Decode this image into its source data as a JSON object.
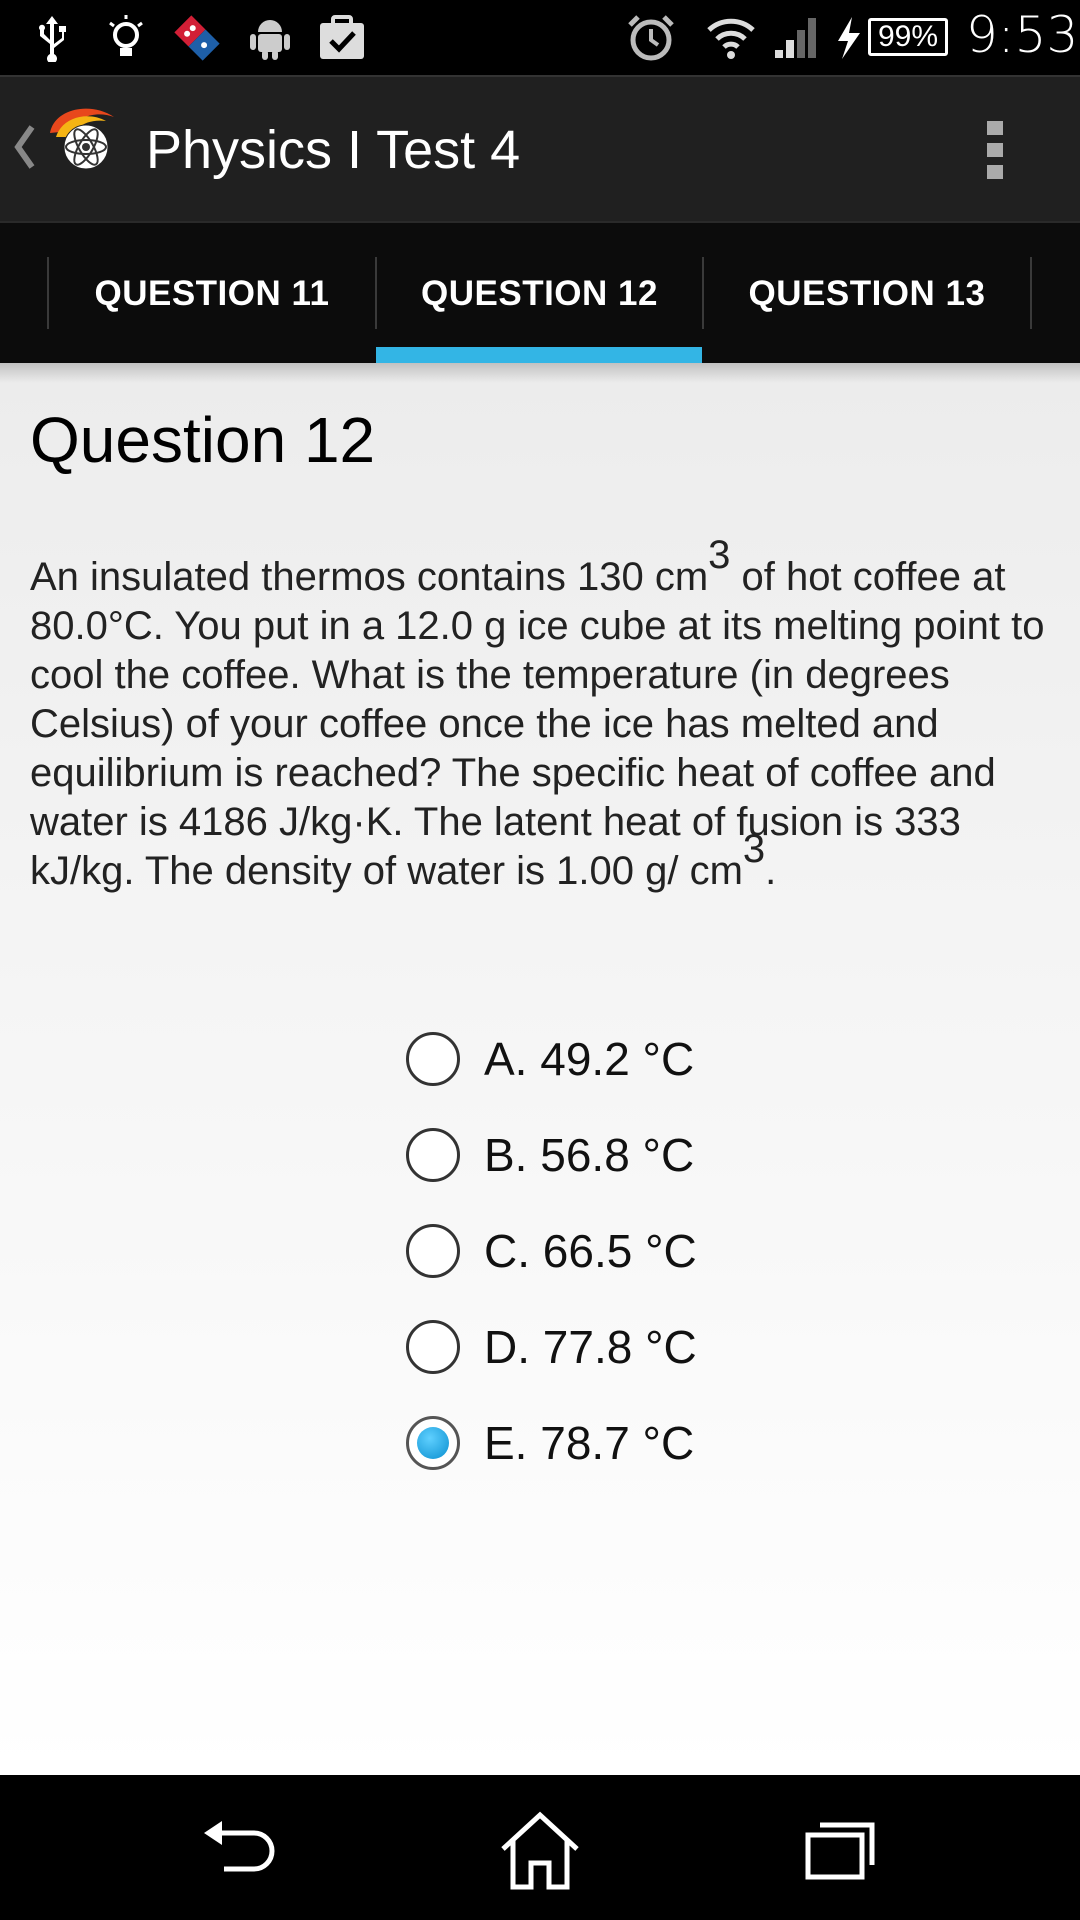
{
  "status_bar": {
    "icons": [
      "usb-icon",
      "lightbulb-icon",
      "dominos-icon",
      "android-icon",
      "clipboard-check-icon",
      "alarm-icon",
      "wifi-icon",
      "signal-icon",
      "charging-icon"
    ],
    "battery": "99%",
    "time": "9:53"
  },
  "action_bar": {
    "title": "Physics I Test 4"
  },
  "tabs": [
    {
      "label": "QUESTION 11"
    },
    {
      "label": "QUESTION 12"
    },
    {
      "label": "QUESTION 13"
    }
  ],
  "selected_tab": "QUESTION 12",
  "question": {
    "title": "Question 12",
    "text_part1": "An insulated thermos contains 130 cm",
    "superscript1": "3",
    "text_part2": " of hot coffee at 80.0°C. You put in a 12.0 g ice cube at its melting point to cool the coffee. What is the temperature (in degrees Celsius) of your coffee once the ice has melted and equilibrium is reached? The specific heat of coffee and water is 4186 J/kg·K. The latent heat of fusion is 333 kJ/kg. The density of water is 1.00 g/ cm",
    "superscript2": "3",
    "text_part3": "."
  },
  "options": [
    {
      "label": "A. 49.2 °C",
      "checked": false
    },
    {
      "label": "B. 56.8 °C",
      "checked": false
    },
    {
      "label": "C. 66.5 °C",
      "checked": false
    },
    {
      "label": "D. 77.8 °C",
      "checked": false
    },
    {
      "label": "E. 78.7 °C",
      "checked": true
    }
  ],
  "colors": {
    "accent": "#33b5e5",
    "action_bar": "#202020",
    "tab_strip": "#0c0c0c"
  }
}
